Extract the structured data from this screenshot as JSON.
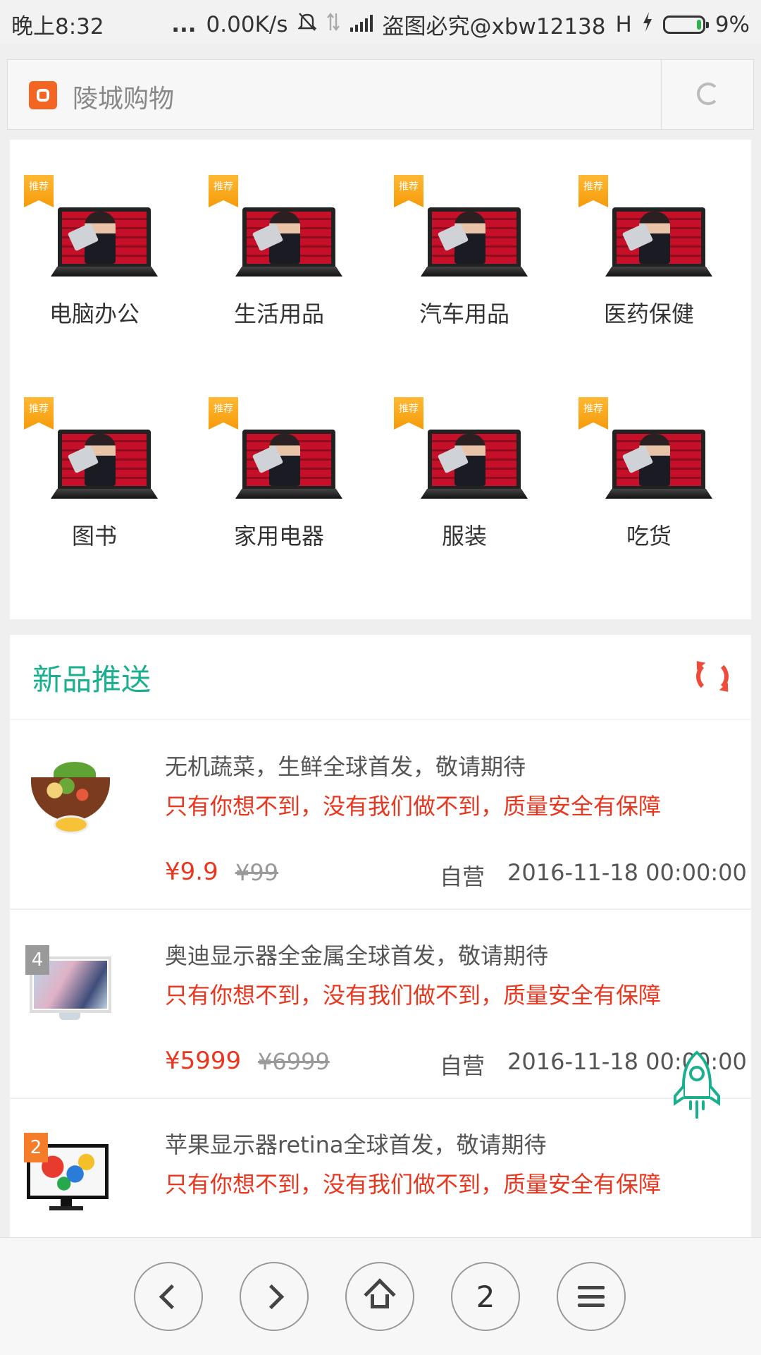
{
  "status_bar": {
    "time": "晚上8:32",
    "dots": "...",
    "net_speed": "0.00K/s",
    "carrier": "盗图必究@xbw12138",
    "network_type": "H",
    "battery": "9%"
  },
  "browser": {
    "page_title": "陵城购物"
  },
  "categories": {
    "badge": "推荐",
    "items": [
      {
        "label": "电脑办公"
      },
      {
        "label": "生活用品"
      },
      {
        "label": "汽车用品"
      },
      {
        "label": "医药保健"
      },
      {
        "label": "图书"
      },
      {
        "label": "家用电器"
      },
      {
        "label": "服装"
      },
      {
        "label": "吃货"
      }
    ]
  },
  "new_products": {
    "title": "新品推送",
    "items": [
      {
        "name": "无机蔬菜，生鲜全球首发，敬请期待",
        "desc": "只有你想不到，没有我们做不到，质量安全有保障",
        "price": "¥9.9",
        "old_price": "¥99",
        "seller": "自营",
        "date": "2016-11-18 00:00:00",
        "rank": ""
      },
      {
        "name": "奥迪显示器全金属全球首发，敬请期待",
        "desc": "只有你想不到，没有我们做不到，质量安全有保障",
        "price": "¥5999",
        "old_price": "¥6999",
        "seller": "自营",
        "date": "2016-11-18 00:00:00",
        "rank": "4"
      },
      {
        "name": "苹果显示器retina全球首发，敬请期待",
        "desc": "只有你想不到，没有我们做不到，质量安全有保障",
        "rank": "2"
      }
    ]
  },
  "bottom_nav": {
    "tab_count": "2"
  },
  "colors": {
    "accent_green": "#1aaf8e",
    "price_red": "#e8361f",
    "badge_orange": "#f59b0a"
  }
}
